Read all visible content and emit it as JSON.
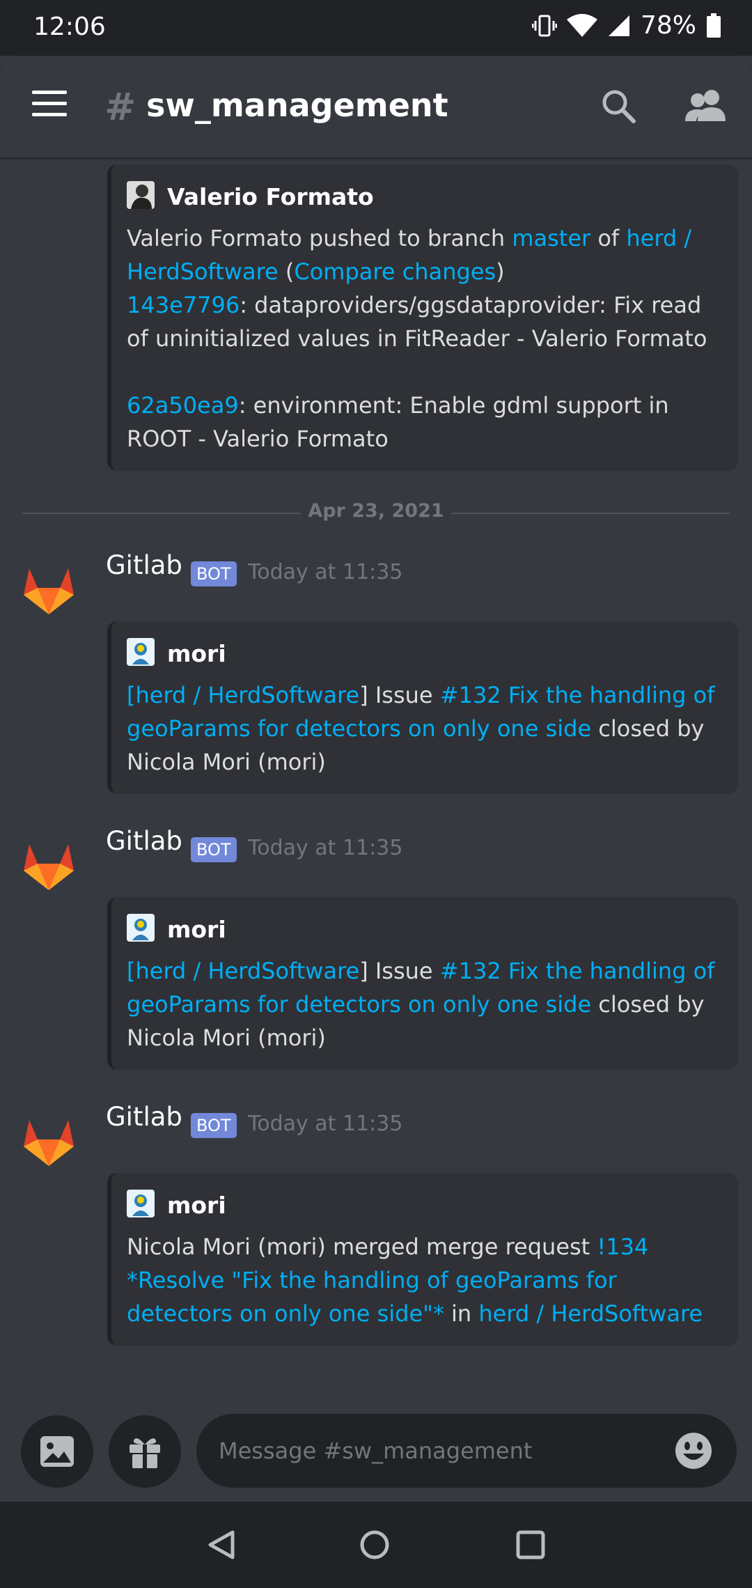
{
  "status_bar": {
    "time": "12:06",
    "battery": "78%"
  },
  "header": {
    "channel_name": "sw_management"
  },
  "messages": {
    "first_embed": {
      "author": "Valerio Formato",
      "line1_prefix": "Valerio Formato pushed to branch ",
      "branch": "master",
      "of": " of ",
      "repo": "herd / HerdSoftware",
      "paren_open": " (",
      "compare": "Compare changes",
      "paren_close": ")",
      "commit1_hash": "143e7796",
      "commit1_text": ": dataproviders/ggsdataprovider: Fix read of uninitialized values in FitReader - Valerio Formato",
      "commit2_hash": "62a50ea9",
      "commit2_text": ": environment: Enable gdml support in ROOT - Valerio Formato"
    },
    "date_divider": "Apr 23, 2021",
    "gitlab_posts": [
      {
        "username": "Gitlab",
        "badge": "BOT",
        "timestamp": "Today at 11:35",
        "embed_author": "mori",
        "repo_link": "[herd / HerdSoftware",
        "mid1": "] Issue ",
        "issue_link": "#132 Fix the handling of geoParams for detectors on only one side",
        "tail": " closed by Nicola Mori (mori)"
      },
      {
        "username": "Gitlab",
        "badge": "BOT",
        "timestamp": "Today at 11:35",
        "embed_author": "mori",
        "repo_link": "[herd / HerdSoftware",
        "mid1": "] Issue ",
        "issue_link": "#132 Fix the handling of geoParams for detectors on only one side",
        "tail": " closed by Nicola Mori (mori)"
      },
      {
        "username": "Gitlab",
        "badge": "BOT",
        "timestamp": "Today at 11:35",
        "embed_author": "mori",
        "prefix": "Nicola Mori (mori) merged merge request ",
        "mr_link": "!134 *Resolve \"Fix the handling of geoParams for detectors on only one side\"*",
        "in": " in ",
        "repo_link": "herd / HerdSoftware"
      }
    ]
  },
  "input": {
    "placeholder": "Message #sw_management"
  },
  "icons": {
    "menu": "hamburger-icon",
    "search": "search-icon",
    "members": "members-icon",
    "image": "image-icon",
    "gift": "gift-icon",
    "emoji": "emoji-icon",
    "back": "back-icon",
    "home": "home-icon",
    "recents": "recents-icon"
  },
  "colors": {
    "background": "#36393f",
    "embed": "#2f3136",
    "link": "#00aff4",
    "bot_badge": "#7289da",
    "bar": "#202225"
  }
}
